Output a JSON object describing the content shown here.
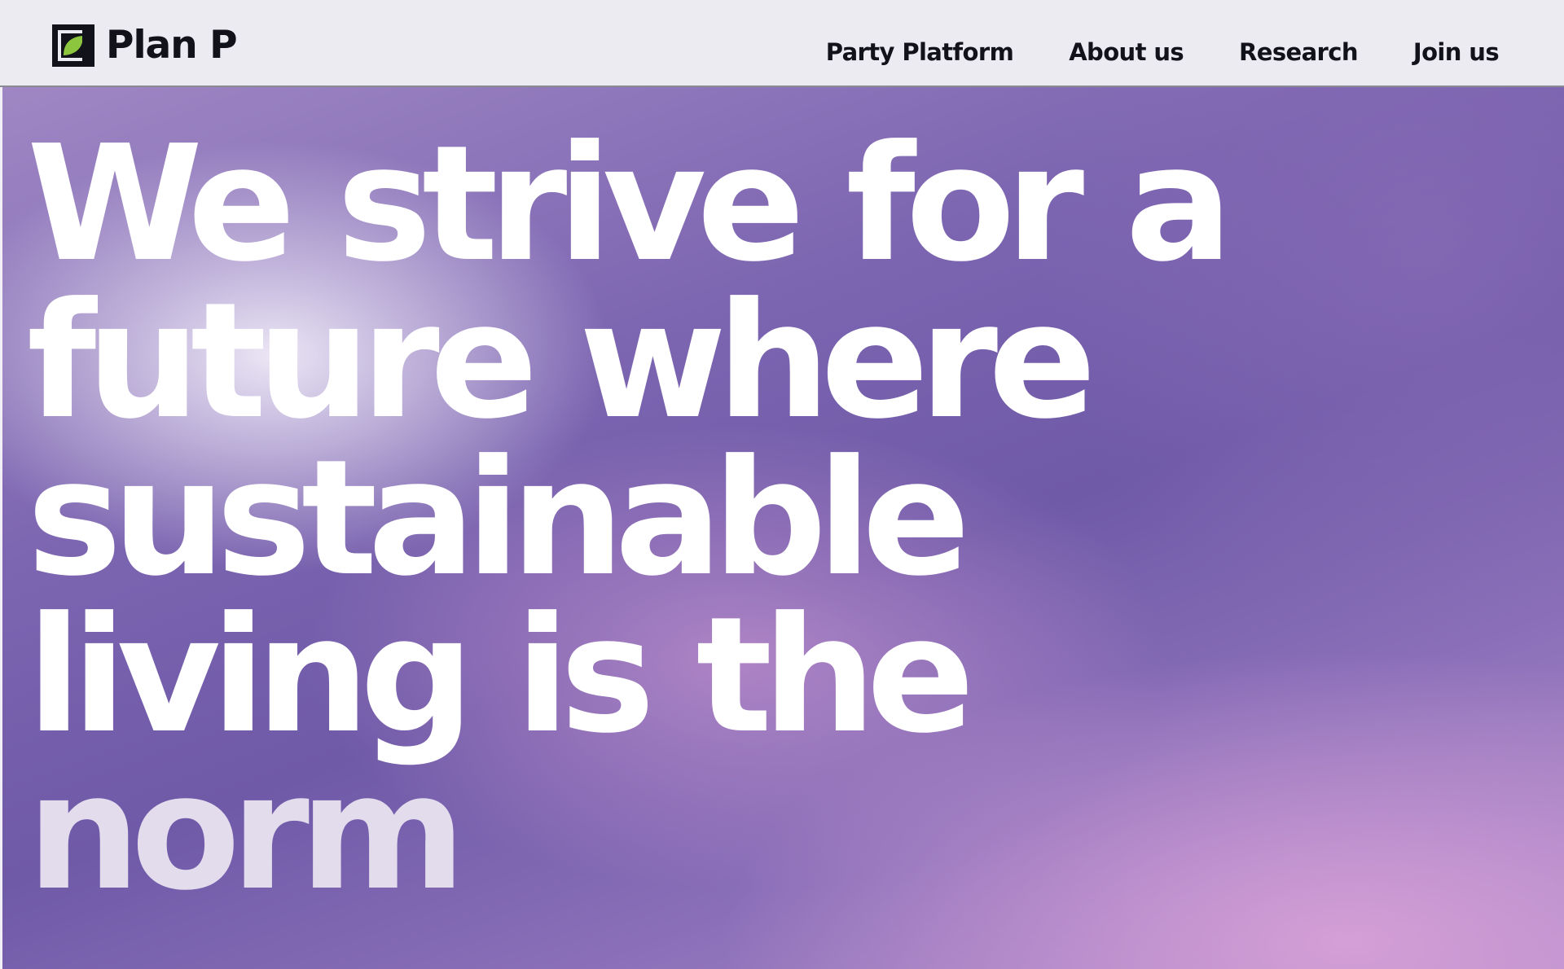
{
  "header": {
    "brand": {
      "name": "Plan P",
      "icon": "plan-p-leaf-logo-icon",
      "colors": {
        "frame": "#12121a",
        "leaf": "#8cc63f"
      }
    },
    "nav": [
      {
        "label": "Party Platform"
      },
      {
        "label": "About us"
      },
      {
        "label": "Research"
      },
      {
        "label": "Join us"
      }
    ]
  },
  "hero": {
    "headline_lines": [
      "We strive for a",
      "future where",
      "sustainable",
      "living is the",
      "norm"
    ],
    "colors": {
      "text": "#ffffff",
      "last_line_text": "#e2dcec",
      "background_primary": "#6f5aa8",
      "background_highlight_light": "#f0ecf8",
      "background_highlight_pink": "#d7a0d7"
    }
  }
}
